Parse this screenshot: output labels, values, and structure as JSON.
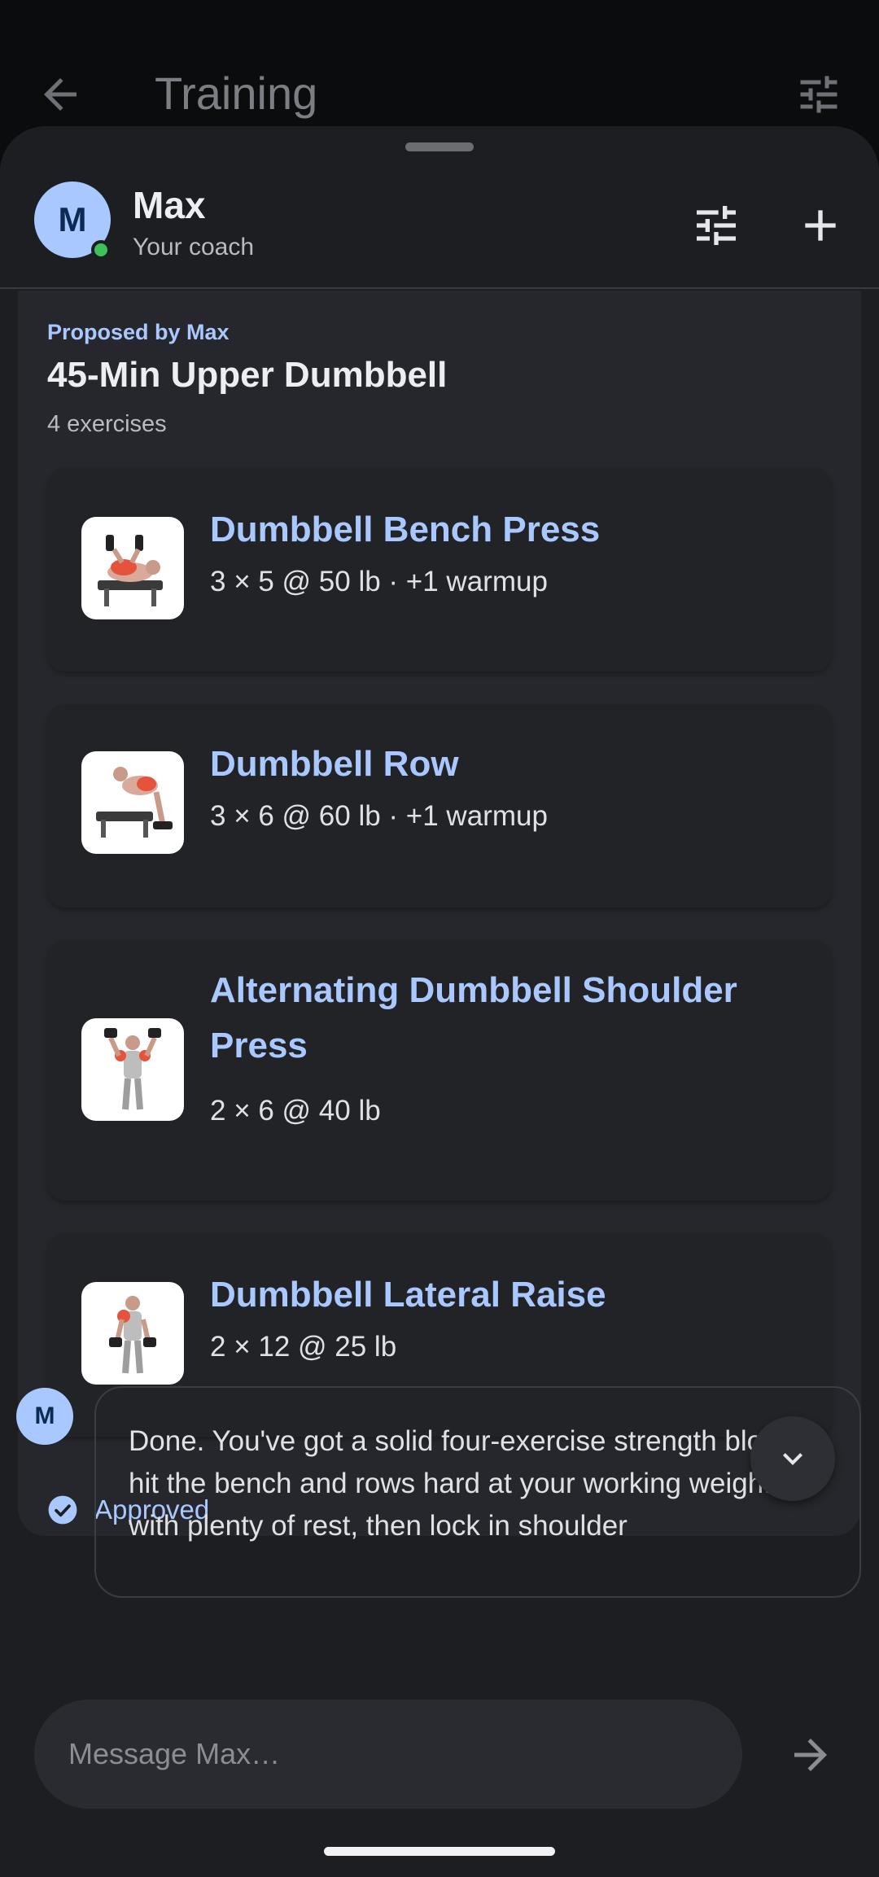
{
  "background": {
    "title": "Training"
  },
  "coach": {
    "initial": "M",
    "name": "Max",
    "subtitle": "Your coach",
    "online_color": "#3ec15a"
  },
  "plan": {
    "proposed_by": "Proposed by Max",
    "title": "45-Min Upper Dumbbell",
    "count": "4 exercises",
    "exercises": [
      {
        "name": "Dumbbell Bench Press",
        "detail": "3 × 5 @ 50 lb · +1 warmup"
      },
      {
        "name": "Dumbbell Row",
        "detail": "3 × 6 @ 60 lb · +1 warmup"
      },
      {
        "name": "Alternating Dumbbell Shoulder Press",
        "detail": "2 × 6 @ 40 lb"
      },
      {
        "name": "Dumbbell Lateral Raise",
        "detail": "2 × 12 @ 25 lb"
      }
    ],
    "status": "Approved"
  },
  "message": {
    "initial": "M",
    "text": "Done. You've got a solid four-exercise strength block: hit the bench and rows hard at your working weights with plenty of rest, then lock in shoulder"
  },
  "composer": {
    "placeholder": "Message Max…"
  },
  "icons": {
    "back": "arrow-back-icon",
    "tune": "tune-icon",
    "add": "plus-icon",
    "approved": "check-circle-icon",
    "scroll": "chevron-down-icon",
    "send": "arrow-forward-icon"
  },
  "colors": {
    "accent": "#a9c8ff",
    "sheet": "#1d1e22",
    "card": "#26272c"
  }
}
